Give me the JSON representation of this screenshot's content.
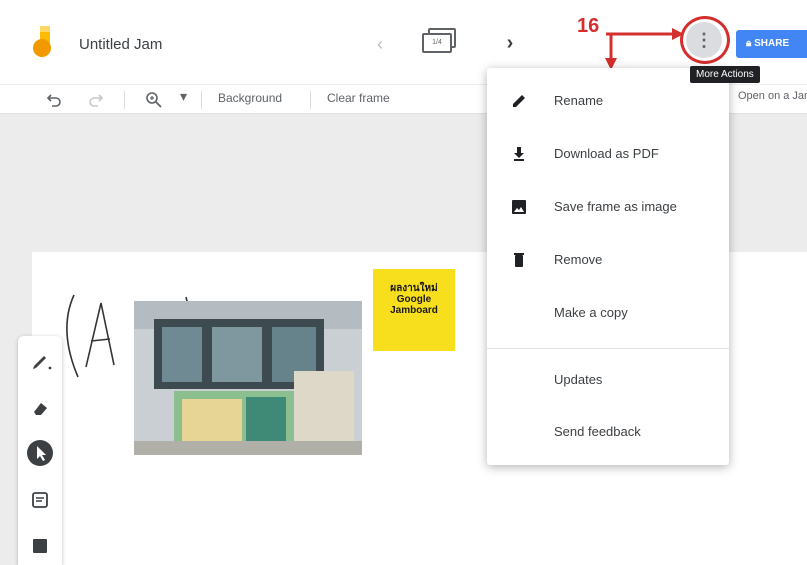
{
  "app": {
    "title": "Untitled Jam",
    "frame_indicator": "1/4"
  },
  "annotation": {
    "step_number": "16"
  },
  "header": {
    "more_actions_tooltip": "More Actions",
    "share_label": "SHARE"
  },
  "toolbar": {
    "background_label": "Background",
    "clear_frame_label": "Clear frame",
    "open_link": "Open on a Jam"
  },
  "menu": {
    "items": [
      {
        "label": "Rename",
        "icon": "pencil-icon"
      },
      {
        "label": "Download as PDF",
        "icon": "download-icon"
      },
      {
        "label": "Save frame as image",
        "icon": "image-icon"
      },
      {
        "label": "Remove",
        "icon": "trash-icon"
      },
      {
        "label": "Make a copy",
        "icon": ""
      },
      {
        "label": "Updates",
        "icon": ""
      },
      {
        "label": "Send feedback",
        "icon": ""
      }
    ]
  },
  "canvas": {
    "sticky_note": [
      "ผลงานใหม่",
      "Google",
      "Jamboard"
    ],
    "sticky_color": "#f7df1e"
  },
  "colors": {
    "accent": "#4285f4",
    "annotation": "#d32f2f"
  }
}
